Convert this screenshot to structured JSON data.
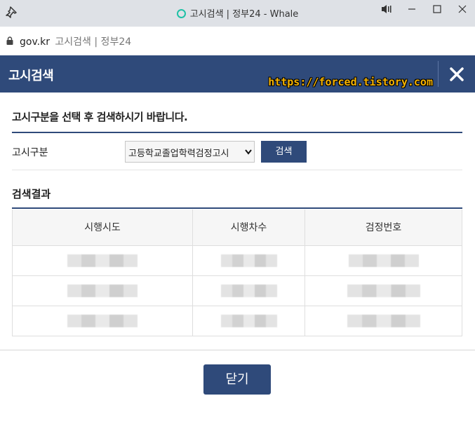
{
  "window": {
    "title": "고시검색 | 정부24 - Whale"
  },
  "address": {
    "domain": "gov.kr",
    "page_title": "고시검색 | 정부24"
  },
  "modal": {
    "title": "고시검색",
    "watermark": "https://forced.tistory.com",
    "instruction": "고시구분을 선택 후 검색하시기 바랍니다.",
    "field_label": "고시구분",
    "select_value": "고등학교졸업학력검정고시",
    "search_label": "검색",
    "results_title": "검색결과",
    "close_label": "닫기"
  },
  "table": {
    "headers": [
      "시행시도",
      "시행차수",
      "검정번호"
    ],
    "rows": [
      [
        "",
        "",
        ""
      ],
      [
        "",
        "",
        ""
      ],
      [
        "",
        "",
        ""
      ]
    ]
  },
  "colors": {
    "accent": "#2f4a7a",
    "titlebar": "#dee1e6",
    "watermark": "#f6b300",
    "tab_indicator": "#1fc1a6"
  },
  "icons": [
    "pin-icon",
    "tab-indicator-icon",
    "speaker-icon",
    "minimize-icon",
    "maximize-icon",
    "window-close-icon",
    "lock-icon",
    "close-icon",
    "chevron-down-icon"
  ]
}
